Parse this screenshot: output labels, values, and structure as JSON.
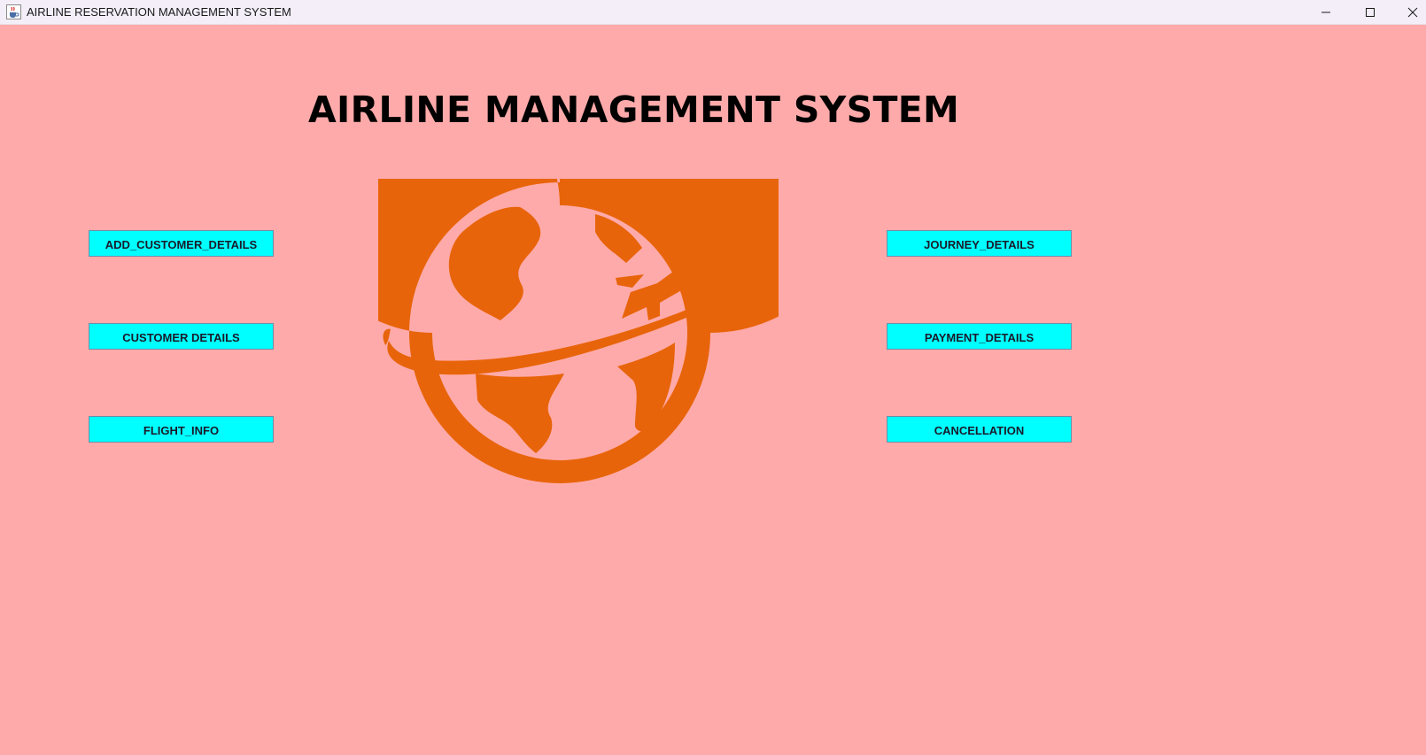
{
  "window": {
    "title": "AIRLINE RESERVATION MANAGEMENT SYSTEM",
    "icon": "java-cup-icon",
    "controls": [
      "minimize-icon",
      "maximize-icon",
      "close-icon"
    ]
  },
  "main": {
    "heading": "AIRLINE MANAGEMENT SYSTEM",
    "logo": "globe-airplane-logo",
    "left_buttons": [
      {
        "label": "ADD_CUSTOMER_DETAILS"
      },
      {
        "label": "CUSTOMER DETAILS"
      },
      {
        "label": "FLIGHT_INFO"
      }
    ],
    "right_buttons": [
      {
        "label": "JOURNEY_DETAILS"
      },
      {
        "label": "PAYMENT_DETAILS"
      },
      {
        "label": "CANCELLATION"
      }
    ]
  },
  "colors": {
    "background": "#ffaaaa",
    "button_fill": "#00ffff",
    "logo": "#e8640a",
    "heading": "#000000"
  }
}
